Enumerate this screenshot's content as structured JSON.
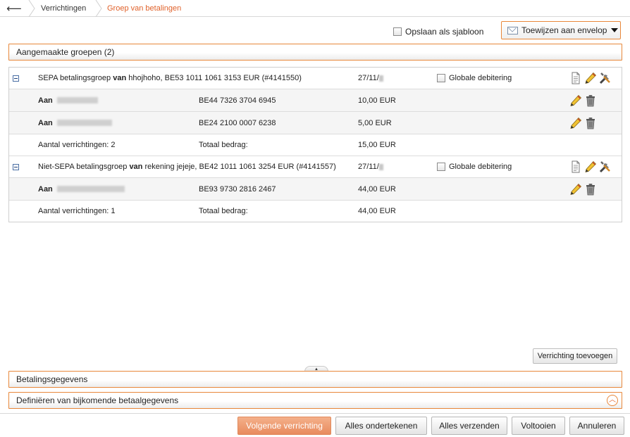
{
  "breadcrumb": {
    "back_glyph": "⟵",
    "items": [
      "Verrichtingen",
      "Groep van betalingen"
    ]
  },
  "toolbar": {
    "save_template_label": "Opslaan als sjabloon",
    "assign_envelope_label": "Toewijzen aan envelop"
  },
  "sections": {
    "groups_header": "Aangemaakte groepen (2)",
    "payment_details": "Betalingsgegevens",
    "extra_details": "Definiëren van bijkomende betaalgegevens"
  },
  "groups": [
    {
      "title_prefix": "SEPA betalingsgroep ",
      "title_bold": "van",
      "title_rest": " hhojhoho, BE53 1011 1061 3153 EUR (#4141550)",
      "date": "27/11/",
      "global_debit_label": "Globale debitering",
      "transactions": [
        {
          "to_label": "Aan",
          "account": "BE44 7326 3704 6945",
          "amount": "10,00 EUR"
        },
        {
          "to_label": "Aan",
          "account": "BE24 2100 0007 6238",
          "amount": "5,00 EUR"
        }
      ],
      "summary": {
        "count_label": "Aantal verrichtingen: 2",
        "total_label": "Totaal bedrag:",
        "total": "15,00 EUR"
      }
    },
    {
      "title_prefix": "Niet-SEPA betalingsgroep ",
      "title_bold": "van",
      "title_rest": " rekening jejeje, BE42 1011 1061 3254 EUR (#4141557)",
      "date": "27/11/",
      "global_debit_label": "Globale debitering",
      "transactions": [
        {
          "to_label": "Aan",
          "account": "BE93 9730 2816 2467",
          "amount": "44,00 EUR"
        }
      ],
      "summary": {
        "count_label": "Aantal verrichtingen: 1",
        "total_label": "Totaal bedrag:",
        "total": "44,00 EUR"
      }
    }
  ],
  "buttons": {
    "add_transaction": "Verrichting toevoegen",
    "next": "Volgende verrichting",
    "sign_all": "Alles ondertekenen",
    "send_all": "Alles verzenden",
    "complete": "Voltooien",
    "cancel": "Annuleren"
  },
  "colors": {
    "accent": "#e8873a",
    "active_crumb": "#e0612a",
    "primary_button": "#e88b5e"
  },
  "icons": [
    "back-arrow-icon",
    "envelope-icon",
    "dropdown-caret-icon",
    "collapse-icon",
    "document-icon",
    "pencil-icon",
    "tools-icon",
    "trash-icon",
    "chevron-up-icon"
  ]
}
